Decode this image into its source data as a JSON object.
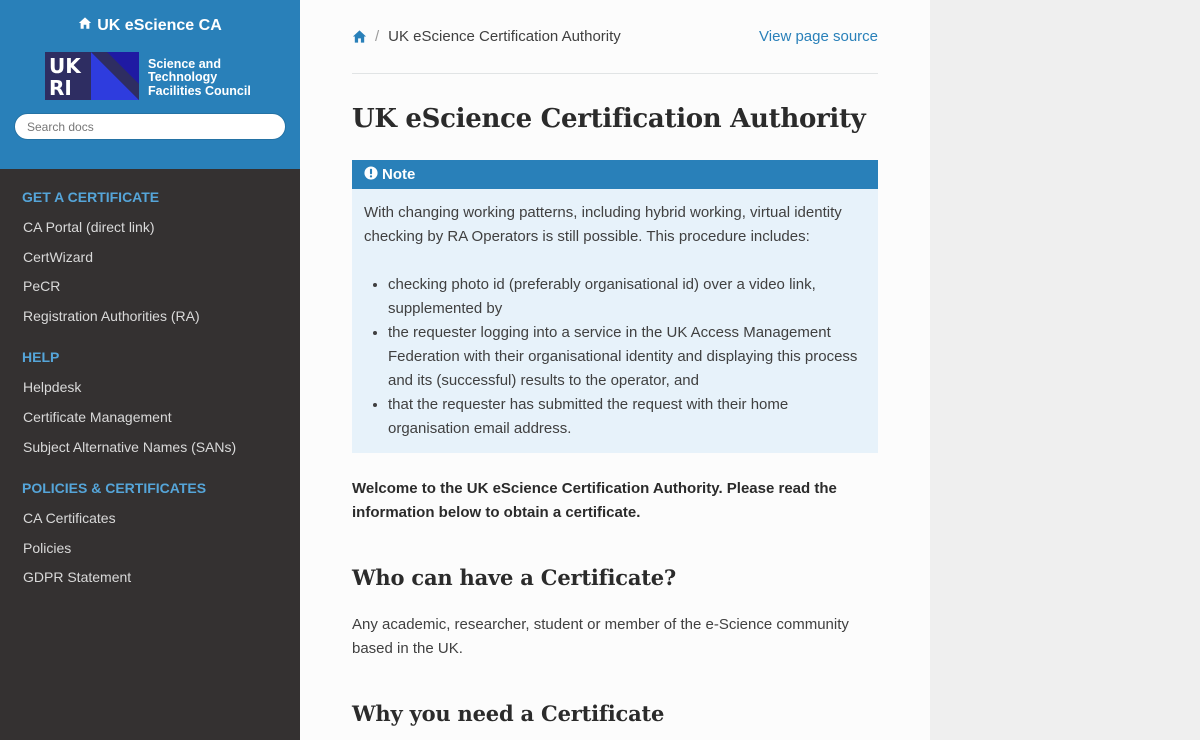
{
  "sidebar": {
    "title": "UK eScience CA",
    "logo": {
      "text_lines": [
        "Science and",
        "Technology",
        "Facilities Council"
      ],
      "mark_letters": [
        "UK",
        "RI"
      ]
    },
    "search_placeholder": "Search docs",
    "sections": [
      {
        "caption": "GET A CERTIFICATE",
        "items": [
          "CA Portal (direct link)",
          "CertWizard",
          "PeCR",
          "Registration Authorities (RA)"
        ]
      },
      {
        "caption": "HELP",
        "items": [
          "Helpdesk",
          "Certificate Management",
          "Subject Alternative Names (SANs)"
        ]
      },
      {
        "caption": "POLICIES & CERTIFICATES",
        "items": [
          "CA Certificates",
          "Policies",
          "GDPR Statement"
        ]
      }
    ]
  },
  "breadcrumb": {
    "separator": "/",
    "current": "UK eScience Certification Authority",
    "source_link": "View page source"
  },
  "page": {
    "title": "UK eScience Certification Authority",
    "note": {
      "title": "Note",
      "text": "With changing working patterns, including hybrid working, virtual identity checking by RA Operators is still possible. This procedure includes:",
      "bullets": [
        "checking photo id (preferably organisational id) over a video link, supplemented by",
        "the requester logging into a service in the UK Access Management Federation with their organisational identity and displaying this process and its (successful) results to the operator, and",
        "that the requester has submitted the request with their home organisation email address."
      ]
    },
    "intro": "Welcome to the UK eScience Certification Authority. Please read the information below to obtain a certificate.",
    "sections": [
      {
        "heading": "Who can have a Certificate?",
        "text": "Any academic, researcher, student or member of the e-Science community based in the UK."
      },
      {
        "heading": "Why you need a Certificate"
      }
    ]
  },
  "colors": {
    "accent": "#2980b9",
    "sidebar_bg": "#343131",
    "note_bg": "#e7f2fa",
    "caption": "#55a5d9"
  },
  "icons": {
    "home": "home-icon",
    "note": "exclamation-circle-icon"
  }
}
